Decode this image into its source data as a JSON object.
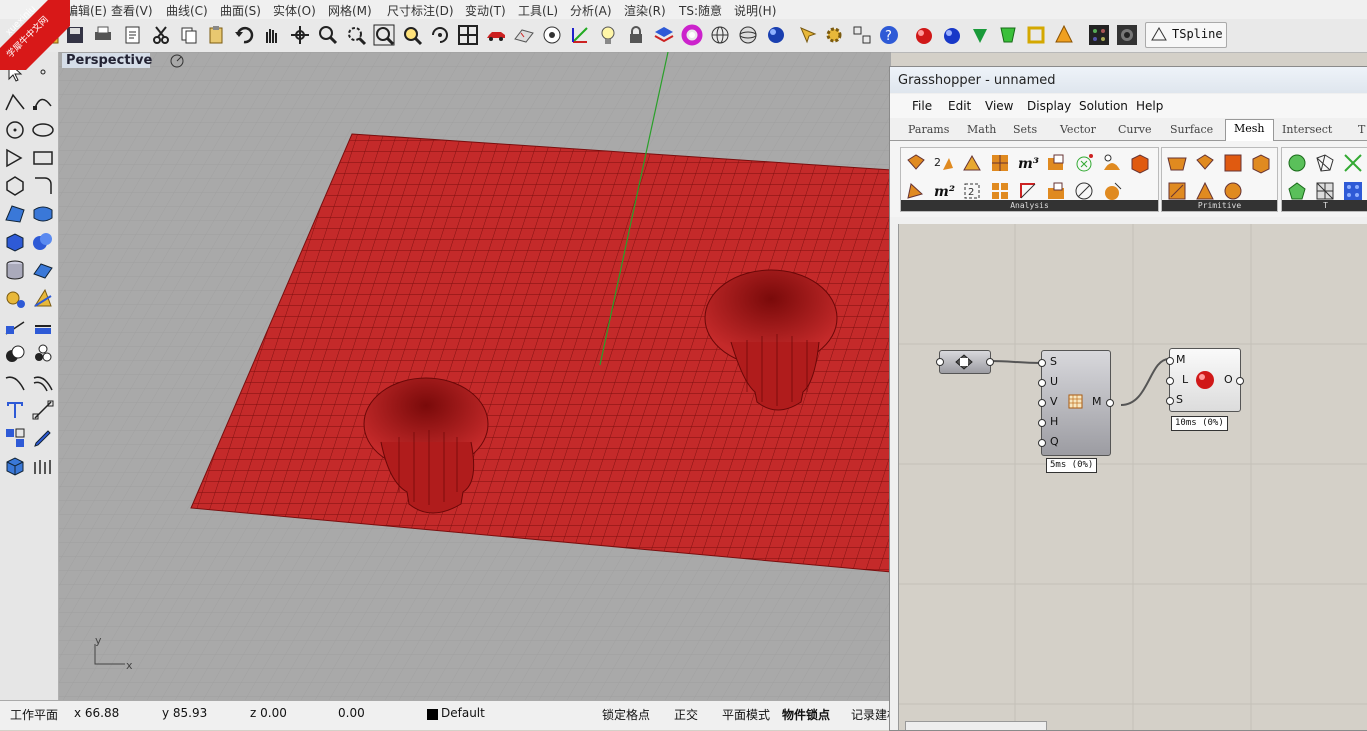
{
  "menu": [
    "编辑(E)",
    "查看(V)",
    "曲线(C)",
    "曲面(S)",
    "实体(O)",
    "网格(M)",
    "尺寸标注(D)",
    "变动(T)",
    "工具(L)",
    "分析(A)",
    "渲染(R)",
    "TS:随意",
    "说明(H)"
  ],
  "logo": {
    "line1": "xuexiniu",
    "line2": "学犀牛中文网"
  },
  "toolbar": {
    "tspline_label": "TSpline"
  },
  "viewport": {
    "label": "Perspective",
    "axis_y": "y",
    "axis_x": "x"
  },
  "status": {
    "workplane": "工作平面",
    "x": "x 66.88",
    "y": "y 85.93",
    "z": "z 0.00",
    "value": "0.00",
    "layer": "Default",
    "grid_snap": "锁定格点",
    "ortho": "正交",
    "planar": "平面模式",
    "osnap": "物件锁点",
    "history": "记录建构"
  },
  "gh": {
    "title": "Grasshopper - unnamed",
    "menu": [
      "File",
      "Edit",
      "View",
      "Display",
      "Solution",
      "Help"
    ],
    "tabs": [
      "Params",
      "Math",
      "Sets",
      "Vector",
      "Curve",
      "Surface",
      "Mesh",
      "Intersect",
      "T"
    ],
    "active_tab": "Mesh",
    "groups": [
      "Analysis",
      "Primitive",
      "T"
    ],
    "node1": {
      "inputs": [
        "S",
        "U",
        "V",
        "H",
        "Q"
      ],
      "output": "M",
      "time": "5ms (0%)"
    },
    "node2": {
      "inputs": [
        "M",
        "L",
        "S"
      ],
      "output": "O",
      "time": "10ms (0%)"
    }
  },
  "colors": {
    "mesh": "#c02020",
    "viewport_bg": "#a9a9a9",
    "canvas_bg": "#d4d0c8"
  }
}
